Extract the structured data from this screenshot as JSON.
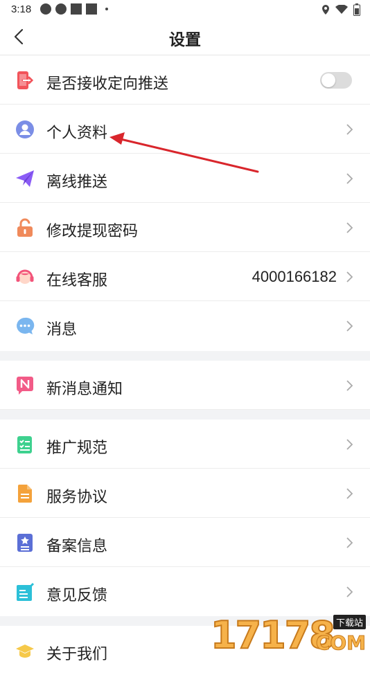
{
  "status_bar": {
    "time": "3:18"
  },
  "header": {
    "title": "设置"
  },
  "rows": [
    {
      "label": "是否接收定向推送",
      "toggle_on": false
    },
    {
      "label": "个人资料"
    },
    {
      "label": "离线推送"
    },
    {
      "label": "修改提现密码"
    },
    {
      "label": "在线客服",
      "value": "4000166182"
    },
    {
      "label": "消息"
    },
    {
      "label": "新消息通知"
    },
    {
      "label": "推广规范"
    },
    {
      "label": "服务协议"
    },
    {
      "label": "备案信息"
    },
    {
      "label": "意见反馈"
    },
    {
      "label": "关于我们"
    }
  ],
  "watermark": {
    "number": "17178",
    "tag": "下载站",
    "domain": "COM"
  },
  "colors": {
    "arrow": "#d9262c",
    "separator": "#f2f3f5",
    "toggle_off": "#dcdcdc"
  }
}
